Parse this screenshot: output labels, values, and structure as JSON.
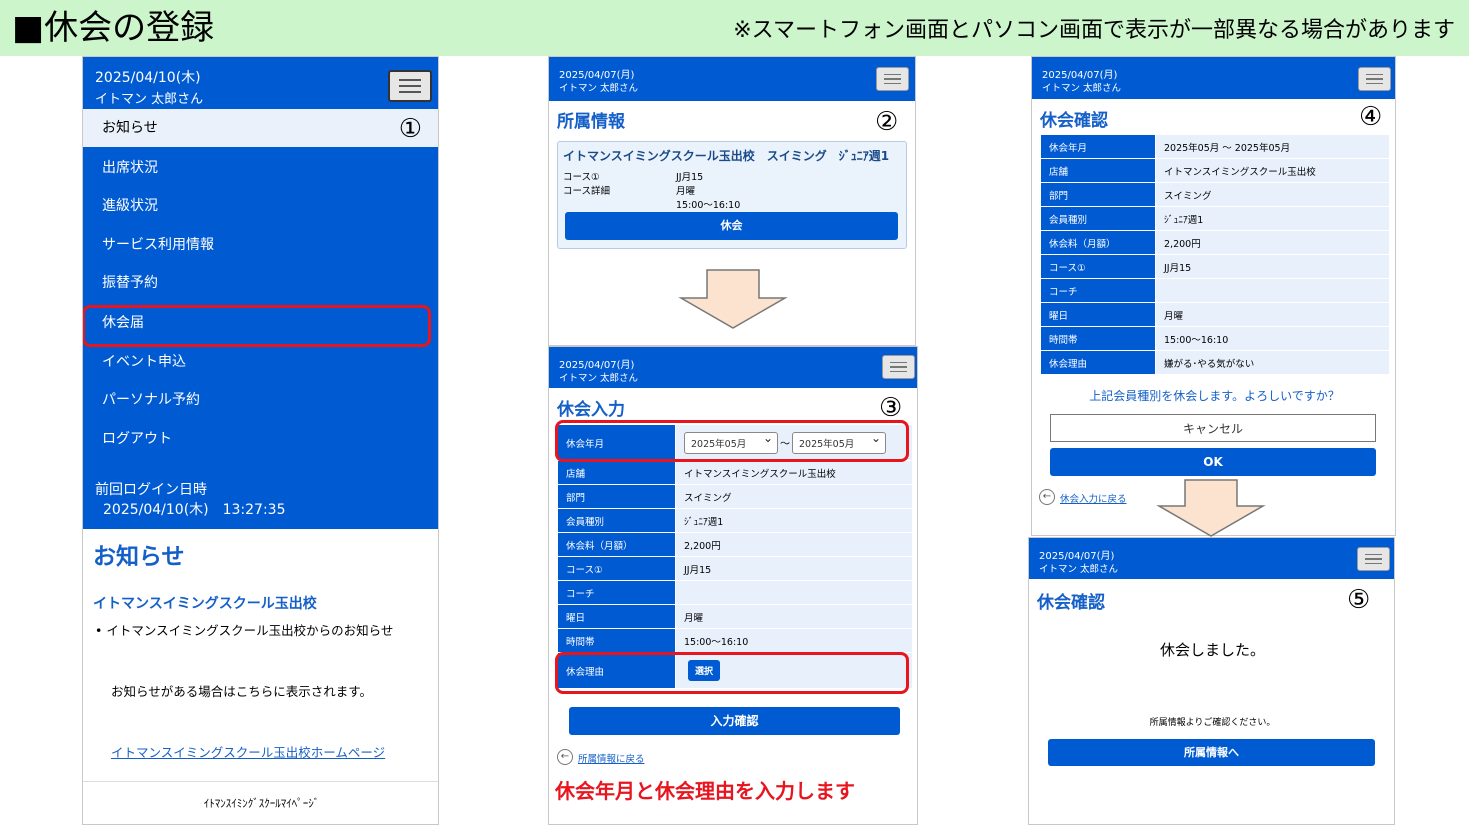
{
  "header": {
    "title": "■休会の登録",
    "note": "※スマートフォン画面とパソコン画面で表示が一部異なる場合があります"
  },
  "panel1": {
    "date": "2025/04/10(木)",
    "user": "イトマン 太郎さん",
    "step": "①",
    "menu": [
      {
        "label": "お知らせ"
      },
      {
        "label": "出席状況"
      },
      {
        "label": "進級状況"
      },
      {
        "label": "サービス利用情報"
      },
      {
        "label": "振替予約"
      },
      {
        "label": "休会届"
      },
      {
        "label": "イベント申込"
      },
      {
        "label": "パーソナル予約"
      },
      {
        "label": "ログアウト"
      }
    ],
    "last_login_label": "前回ログイン日時",
    "last_login_value": "2025/04/10(木)　13:27:35",
    "news_title": "お知らせ",
    "school_name": "イトマンスイミングスクール玉出校",
    "bullet": "イトマンスイミングスクール玉出校からのお知らせ",
    "news_note": "お知らせがある場合はこちらに表示されます。",
    "homepage_link": "イトマンスイミングスクール玉出校ホームページ",
    "footer": "ｲﾄﾏﾝｽｲﾐﾝｸﾞｽｸｰﾙﾏｲﾍﾟｰｼﾞ"
  },
  "panel2": {
    "date": "2025/04/07(月)",
    "user": "イトマン 太郎さん",
    "title": "所属情報",
    "step": "②",
    "card_title": "イトマンスイミングスクール玉出校　スイミング　ｼﾞｭﾆｱ週1",
    "rows": [
      {
        "k": "コース①",
        "v": "JJ月15"
      },
      {
        "k": "コース詳細",
        "v": "月曜"
      },
      {
        "k": "",
        "v": "15:00～16:10"
      }
    ],
    "button": "休会"
  },
  "panel3": {
    "date": "2025/04/07(月)",
    "user": "イトマン 太郎さん",
    "title": "休会入力",
    "step": "③",
    "period_label": "休会年月",
    "period_from": "2025年05月",
    "period_to": "2025年05月",
    "tilde": "～",
    "rows": [
      {
        "k": "店舗",
        "v": "イトマンスイミングスクール玉出校"
      },
      {
        "k": "部門",
        "v": "スイミング"
      },
      {
        "k": "会員種別",
        "v": "ｼﾞｭﾆｱ週1"
      },
      {
        "k": "休会料（月額）",
        "v": "2,200円"
      },
      {
        "k": "コース①",
        "v": "JJ月15"
      },
      {
        "k": "コーチ",
        "v": ""
      },
      {
        "k": "曜日",
        "v": "月曜"
      },
      {
        "k": "時間帯",
        "v": "15:00～16:10"
      }
    ],
    "reason_label": "休会理由",
    "choose_button": "選択",
    "confirm_button": "入力確認",
    "back_link": "所属情報に戻る",
    "instruction": "休会年月と休会理由を入力します"
  },
  "panel4": {
    "date": "2025/04/07(月)",
    "user": "イトマン 太郎さん",
    "title": "休会確認",
    "step": "④",
    "rows": [
      {
        "k": "休会年月",
        "v": "2025年05月 ～ 2025年05月"
      },
      {
        "k": "店舗",
        "v": "イトマンスイミングスクール玉出校"
      },
      {
        "k": "部門",
        "v": "スイミング"
      },
      {
        "k": "会員種別",
        "v": "ｼﾞｭﾆｱ週1"
      },
      {
        "k": "休会料（月額）",
        "v": "2,200円"
      },
      {
        "k": "コース①",
        "v": "JJ月15"
      },
      {
        "k": "コーチ",
        "v": ""
      },
      {
        "k": "曜日",
        "v": "月曜"
      },
      {
        "k": "時間帯",
        "v": "15:00～16:10"
      },
      {
        "k": "休会理由",
        "v": "嫌がる･やる気がない"
      }
    ],
    "question": "上記会員種別を休会します。よろしいですか？",
    "cancel_button": "キャンセル",
    "ok_button": "OK",
    "back_link": "休会入力に戻る"
  },
  "panel5": {
    "date": "2025/04/07(月)",
    "user": "イトマン 太郎さん",
    "title": "休会確認",
    "step": "⑤",
    "message": "休会しました。",
    "sub_message": "所属情報よりご確認ください。",
    "button": "所属情報へ"
  },
  "colors": {
    "header_bg": "#ccf5cc",
    "primary": "#005bd3",
    "highlight": "#e8151e",
    "row_bg": "#e8f0fb"
  }
}
